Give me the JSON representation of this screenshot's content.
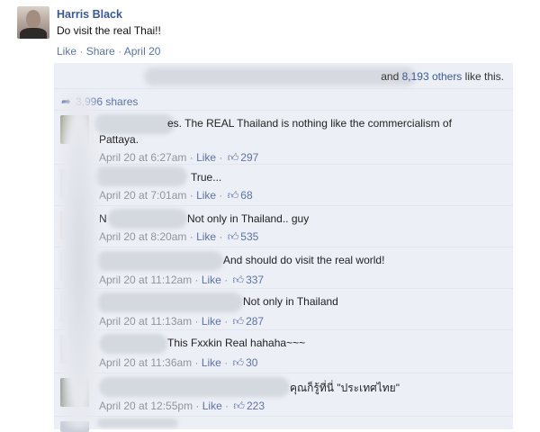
{
  "post": {
    "author": "Harris Black",
    "text": "Do visit the real Thai!!",
    "actions": {
      "like": "Like",
      "share": "Share",
      "date": "April 20",
      "separator": "·"
    }
  },
  "ufi": {
    "likes_tail_pre": "and ",
    "likes_count_link": "8,193 others",
    "likes_tail_post": " like this.",
    "shares": "3,996 shares"
  },
  "comments": [
    {
      "text": "es. The REAL Thailand is nothing like the commercialism of",
      "text2": "Pattaya.",
      "time": "April 20 at 6:27am",
      "like": "Like",
      "count": "297"
    },
    {
      "text": "True...",
      "time": "April 20 at 7:01am",
      "like": "Like",
      "count": "68"
    },
    {
      "text": "Not only in Thailand.. guy",
      "time": "April 20 at 8:20am",
      "like": "Like",
      "count": "535",
      "prefix": "N"
    },
    {
      "text": "And should do visit the real world!",
      "time": "April 20 at 11:12am",
      "like": "Like",
      "count": "337"
    },
    {
      "text": "Not only in Thailand",
      "time": "April 20 at 11:13am",
      "like": "Like",
      "count": "287"
    },
    {
      "text": "This Fxxkin Real hahaha~~~",
      "time": "April 20 at 11:36am",
      "like": "Like",
      "count": "30"
    },
    {
      "text": "คุณก็รู้ที่นี่ \"ประเทศไทย\"",
      "time": "April 20 at 12:55pm",
      "like": "Like",
      "count": "223"
    }
  ],
  "icons": {
    "share": "share-arrow-icon",
    "thumb": "thumbs-up-icon"
  },
  "colors": {
    "link": "#3b5998",
    "ufi_bg": "#eceff5",
    "meta": "#90949c"
  }
}
